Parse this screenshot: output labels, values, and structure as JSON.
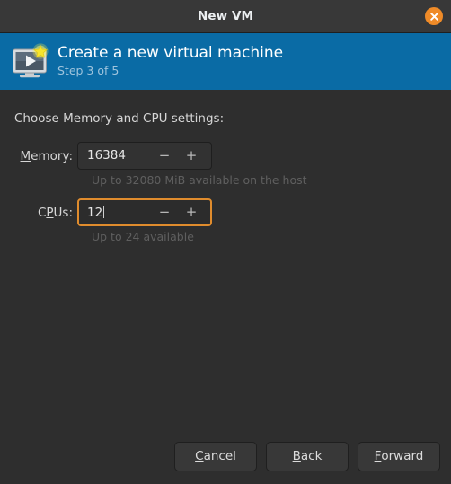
{
  "window": {
    "title": "New VM",
    "close_icon": "close-icon"
  },
  "banner": {
    "icon": "virtual-machine-new-icon",
    "title": "Create a new virtual machine",
    "subtitle": "Step 3 of 5"
  },
  "form": {
    "prompt": "Choose Memory and CPU settings:",
    "memory": {
      "label_prefix": "",
      "label_mnemonic": "M",
      "label_suffix": "emory:",
      "value": "16384",
      "decrement_icon": "minus-icon",
      "decrement_label": "−",
      "increment_icon": "plus-icon",
      "increment_label": "+",
      "hint": "Up to 32080 MiB available on the host"
    },
    "cpus": {
      "label_prefix": "C",
      "label_mnemonic": "P",
      "label_suffix": "Us:",
      "value": "12",
      "decrement_icon": "minus-icon",
      "decrement_label": "−",
      "increment_icon": "plus-icon",
      "increment_label": "+",
      "hint": "Up to 24 available",
      "focused": true
    }
  },
  "footer": {
    "cancel": {
      "mnemonic": "C",
      "rest": "ancel"
    },
    "back": {
      "mnemonic": "B",
      "rest": "ack"
    },
    "forward": {
      "mnemonic": "F",
      "rest": "orward"
    }
  },
  "colors": {
    "banner_blue": "#0a6ba5",
    "accent_orange": "#e08c2d",
    "close_orange": "#ef8b28",
    "window_bg": "#2e2e2e",
    "titlebar_bg": "#383838",
    "hint_text": "#5f5f5f"
  }
}
